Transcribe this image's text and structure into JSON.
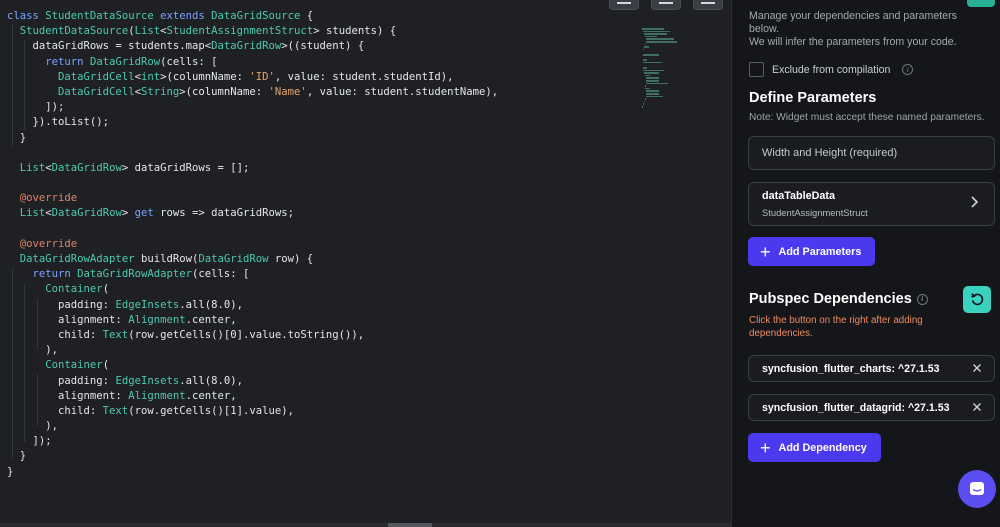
{
  "editor": {
    "code_lines": [
      [
        {
          "t": "kw",
          "s": "class "
        },
        {
          "t": "type",
          "s": "StudentDataSource "
        },
        {
          "t": "kw",
          "s": "extends "
        },
        {
          "t": "type",
          "s": "DataGridSource"
        },
        {
          "t": "plain",
          "s": " {"
        }
      ],
      [
        {
          "t": "plain",
          "s": "  "
        },
        {
          "t": "type",
          "s": "StudentDataSource"
        },
        {
          "t": "plain",
          "s": "("
        },
        {
          "t": "type",
          "s": "List"
        },
        {
          "t": "plain",
          "s": "<"
        },
        {
          "t": "type",
          "s": "StudentAssignmentStruct"
        },
        {
          "t": "plain",
          "s": "> students) {"
        }
      ],
      [
        {
          "t": "plain",
          "s": "    dataGridRows = students.map<"
        },
        {
          "t": "type",
          "s": "DataGridRow"
        },
        {
          "t": "plain",
          "s": ">((student) {"
        }
      ],
      [
        {
          "t": "plain",
          "s": "      "
        },
        {
          "t": "kw",
          "s": "return "
        },
        {
          "t": "type",
          "s": "DataGridRow"
        },
        {
          "t": "plain",
          "s": "(cells: ["
        }
      ],
      [
        {
          "t": "plain",
          "s": "        "
        },
        {
          "t": "type",
          "s": "DataGridCell"
        },
        {
          "t": "plain",
          "s": "<"
        },
        {
          "t": "type",
          "s": "int"
        },
        {
          "t": "plain",
          "s": ">(columnName: "
        },
        {
          "t": "str",
          "s": "'ID'"
        },
        {
          "t": "plain",
          "s": ", value: student.studentId),"
        }
      ],
      [
        {
          "t": "plain",
          "s": "        "
        },
        {
          "t": "type",
          "s": "DataGridCell"
        },
        {
          "t": "plain",
          "s": "<"
        },
        {
          "t": "type",
          "s": "String"
        },
        {
          "t": "plain",
          "s": ">(columnName: "
        },
        {
          "t": "str",
          "s": "'Name'"
        },
        {
          "t": "plain",
          "s": ", value: student.studentName),"
        }
      ],
      [
        {
          "t": "plain",
          "s": "      ]);"
        }
      ],
      [
        {
          "t": "plain",
          "s": "    }).toList();"
        }
      ],
      [
        {
          "t": "plain",
          "s": "  }"
        }
      ],
      [
        {
          "t": "plain",
          "s": ""
        }
      ],
      [
        {
          "t": "plain",
          "s": "  "
        },
        {
          "t": "type",
          "s": "List"
        },
        {
          "t": "plain",
          "s": "<"
        },
        {
          "t": "type",
          "s": "DataGridRow"
        },
        {
          "t": "plain",
          "s": "> dataGridRows = [];"
        }
      ],
      [
        {
          "t": "plain",
          "s": ""
        }
      ],
      [
        {
          "t": "plain",
          "s": "  "
        },
        {
          "t": "ann",
          "s": "@override"
        }
      ],
      [
        {
          "t": "plain",
          "s": "  "
        },
        {
          "t": "type",
          "s": "List"
        },
        {
          "t": "plain",
          "s": "<"
        },
        {
          "t": "type",
          "s": "DataGridRow"
        },
        {
          "t": "plain",
          "s": "> "
        },
        {
          "t": "kw",
          "s": "get"
        },
        {
          "t": "plain",
          "s": " rows => dataGridRows;"
        }
      ],
      [
        {
          "t": "plain",
          "s": ""
        }
      ],
      [
        {
          "t": "plain",
          "s": "  "
        },
        {
          "t": "ann",
          "s": "@override"
        }
      ],
      [
        {
          "t": "plain",
          "s": "  "
        },
        {
          "t": "type",
          "s": "DataGridRowAdapter"
        },
        {
          "t": "plain",
          "s": " buildRow("
        },
        {
          "t": "type",
          "s": "DataGridRow"
        },
        {
          "t": "plain",
          "s": " row) {"
        }
      ],
      [
        {
          "t": "plain",
          "s": "    "
        },
        {
          "t": "kw",
          "s": "return "
        },
        {
          "t": "type",
          "s": "DataGridRowAdapter"
        },
        {
          "t": "plain",
          "s": "(cells: ["
        }
      ],
      [
        {
          "t": "plain",
          "s": "      "
        },
        {
          "t": "type",
          "s": "Container"
        },
        {
          "t": "plain",
          "s": "("
        }
      ],
      [
        {
          "t": "plain",
          "s": "        padding: "
        },
        {
          "t": "type",
          "s": "EdgeInsets"
        },
        {
          "t": "plain",
          "s": ".all(8.0),"
        }
      ],
      [
        {
          "t": "plain",
          "s": "        alignment: "
        },
        {
          "t": "type",
          "s": "Alignment"
        },
        {
          "t": "plain",
          "s": ".center,"
        }
      ],
      [
        {
          "t": "plain",
          "s": "        child: "
        },
        {
          "t": "type",
          "s": "Text"
        },
        {
          "t": "plain",
          "s": "(row.getCells()[0].value.toString()),"
        }
      ],
      [
        {
          "t": "plain",
          "s": "      ),"
        }
      ],
      [
        {
          "t": "plain",
          "s": "      "
        },
        {
          "t": "type",
          "s": "Container"
        },
        {
          "t": "plain",
          "s": "("
        }
      ],
      [
        {
          "t": "plain",
          "s": "        padding: "
        },
        {
          "t": "type",
          "s": "EdgeInsets"
        },
        {
          "t": "plain",
          "s": ".all(8.0),"
        }
      ],
      [
        {
          "t": "plain",
          "s": "        alignment: "
        },
        {
          "t": "type",
          "s": "Alignment"
        },
        {
          "t": "plain",
          "s": ".center,"
        }
      ],
      [
        {
          "t": "plain",
          "s": "        child: "
        },
        {
          "t": "type",
          "s": "Text"
        },
        {
          "t": "plain",
          "s": "(row.getCells()[1].value),"
        }
      ],
      [
        {
          "t": "plain",
          "s": "      ),"
        }
      ],
      [
        {
          "t": "plain",
          "s": "    ]);"
        }
      ],
      [
        {
          "t": "plain",
          "s": "  }"
        }
      ],
      [
        {
          "t": "plain",
          "s": "}"
        }
      ]
    ],
    "top_icons": [
      "collapse-icon",
      "format-icon",
      "menu-icon"
    ]
  },
  "panel": {
    "description": "Manage your dependencies and parameters below.",
    "description_line2": "We will infer the parameters from your code.",
    "exclude_label": "Exclude from compilation",
    "define_title": "Define Parameters",
    "define_note": "Note: Widget must accept these named parameters.",
    "size_field_label": "Width and Height (required)",
    "param": {
      "name": "dataTableData",
      "type": "StudentAssignmentStruct"
    },
    "add_parameters_label": "Add Parameters",
    "pubspec_title": "Pubspec Dependencies",
    "pubspec_warning": "Click the button on the right after adding dependencies.",
    "dependencies": [
      "syncfusion_flutter_charts: ^27.1.53",
      "syncfusion_flutter_datagrid: ^27.1.53"
    ],
    "add_dependency_label": "Add Dependency"
  },
  "colors": {
    "accent": "#4b39ef",
    "teal": "#39d2c0",
    "warning": "#ee8b60",
    "code_keyword": "#7aa2ff",
    "code_type": "#4ec9b0",
    "code_string": "#e6a36c",
    "code_annotation": "#e2826b"
  }
}
